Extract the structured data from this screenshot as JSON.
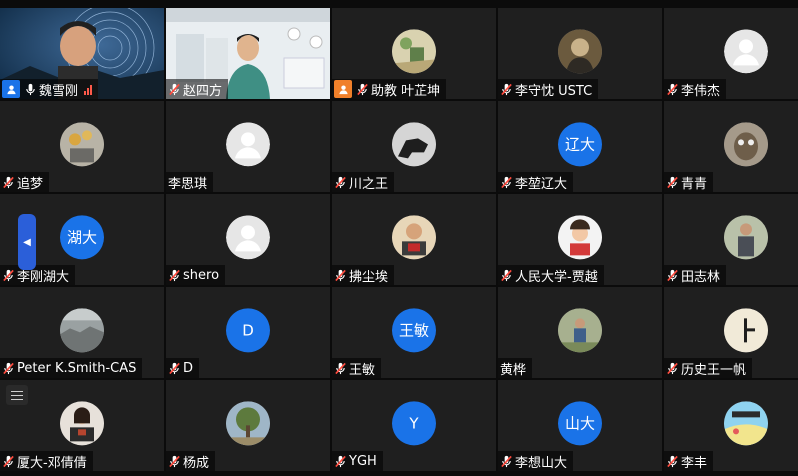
{
  "participants": [
    {
      "name": "魏雪刚",
      "avatar_type": "video",
      "video_style": "host",
      "host": true,
      "host_badge": "person-blue-icon",
      "mic": "on",
      "signal": true
    },
    {
      "name": "赵四方",
      "avatar_type": "video",
      "video_style": "office",
      "mic": "muted"
    },
    {
      "name": "助教 叶芷坤",
      "avatar_type": "photo",
      "photo_style": "cartoon",
      "host": true,
      "host_badge": "person-orange-icon",
      "mic": "muted"
    },
    {
      "name": "李守忱 USTC",
      "avatar_type": "photo",
      "photo_style": "portrait-sepia",
      "mic": "muted"
    },
    {
      "name": "李伟杰",
      "avatar_type": "default",
      "mic": "muted"
    },
    {
      "name": "追梦",
      "avatar_type": "photo",
      "photo_style": "flowers",
      "mic": "muted"
    },
    {
      "name": "李思琪",
      "avatar_type": "default",
      "mic": "none"
    },
    {
      "name": "川之王",
      "avatar_type": "photo",
      "photo_style": "dark-horse",
      "mic": "muted"
    },
    {
      "name": "李堃辽大",
      "avatar_type": "text",
      "avatar_text": "辽大",
      "mic": "muted"
    },
    {
      "name": "青青",
      "avatar_type": "photo",
      "photo_style": "owl",
      "mic": "muted"
    },
    {
      "name": "李刚湖大",
      "avatar_type": "text",
      "avatar_text": "湖大",
      "mic": "muted"
    },
    {
      "name": "shero",
      "avatar_type": "default",
      "mic": "muted"
    },
    {
      "name": "拂尘埃",
      "avatar_type": "photo",
      "photo_style": "child",
      "mic": "muted"
    },
    {
      "name": "人民大学-贾越",
      "avatar_type": "photo",
      "photo_style": "girl-red",
      "mic": "muted"
    },
    {
      "name": "田志林",
      "avatar_type": "photo",
      "photo_style": "man-outdoor",
      "mic": "muted"
    },
    {
      "name": "Peter K.Smith-CAS",
      "avatar_type": "photo",
      "photo_style": "landscape",
      "mic": "muted"
    },
    {
      "name": "D",
      "avatar_type": "text",
      "avatar_text": "D",
      "mic": "muted"
    },
    {
      "name": "王敏",
      "avatar_type": "text",
      "avatar_text": "王敏",
      "mic": "muted"
    },
    {
      "name": "黄桦",
      "avatar_type": "photo",
      "photo_style": "man-grass",
      "mic": "none"
    },
    {
      "name": "历史王一帆",
      "avatar_type": "photo",
      "photo_style": "glyph",
      "mic": "muted"
    },
    {
      "name": "厦大-邓倩倩",
      "avatar_type": "photo",
      "photo_style": "woman-grad",
      "mic": "muted"
    },
    {
      "name": "杨成",
      "avatar_type": "photo",
      "photo_style": "tree",
      "mic": "muted"
    },
    {
      "name": "YGH",
      "avatar_type": "text",
      "avatar_text": "Y",
      "mic": "muted"
    },
    {
      "name": "李想山大",
      "avatar_type": "text",
      "avatar_text": "山大",
      "mic": "muted"
    },
    {
      "name": "李丰",
      "avatar_type": "photo",
      "photo_style": "cartoon-scene",
      "mic": "muted"
    }
  ],
  "colors": {
    "avatar_blue": "#1a73e8",
    "tile_bg": "#1f1f1f",
    "muted_red": "#ff4b3e",
    "host_orange": "#f0802a"
  },
  "side_handle_icon": "chevron-left-icon",
  "menu_icon": "hamburger-menu-icon"
}
